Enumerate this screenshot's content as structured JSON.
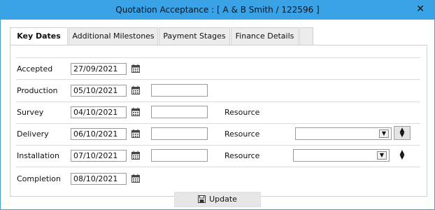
{
  "window": {
    "title": "Quotation Acceptance : [ A & B Smith / 122596 ]",
    "close_label": "✕"
  },
  "tabs": [
    {
      "label": "Key Dates"
    },
    {
      "label": "Additional Milestones"
    },
    {
      "label": "Payment Stages"
    },
    {
      "label": "Finance Details"
    }
  ],
  "fields": [
    {
      "label": "Accepted",
      "date": "27/09/2021"
    },
    {
      "label": "Production",
      "date": "05/10/2021"
    },
    {
      "label": "Survey",
      "date": "04/10/2021",
      "resource_label": "Resource"
    },
    {
      "label": "Delivery",
      "date": "06/10/2021",
      "resource_label": "Resource"
    },
    {
      "label": "Installation",
      "date": "07/10/2021",
      "resource_label": "Resource"
    },
    {
      "label": "Completion",
      "date": "08/10/2021"
    }
  ],
  "footer": {
    "update_label": "Update"
  },
  "colors": {
    "titlebar": "#3aa2e6",
    "border": "#3aa0e0"
  },
  "icons": {
    "calendar": "calendar-icon",
    "save": "save-icon",
    "close": "close-icon"
  }
}
